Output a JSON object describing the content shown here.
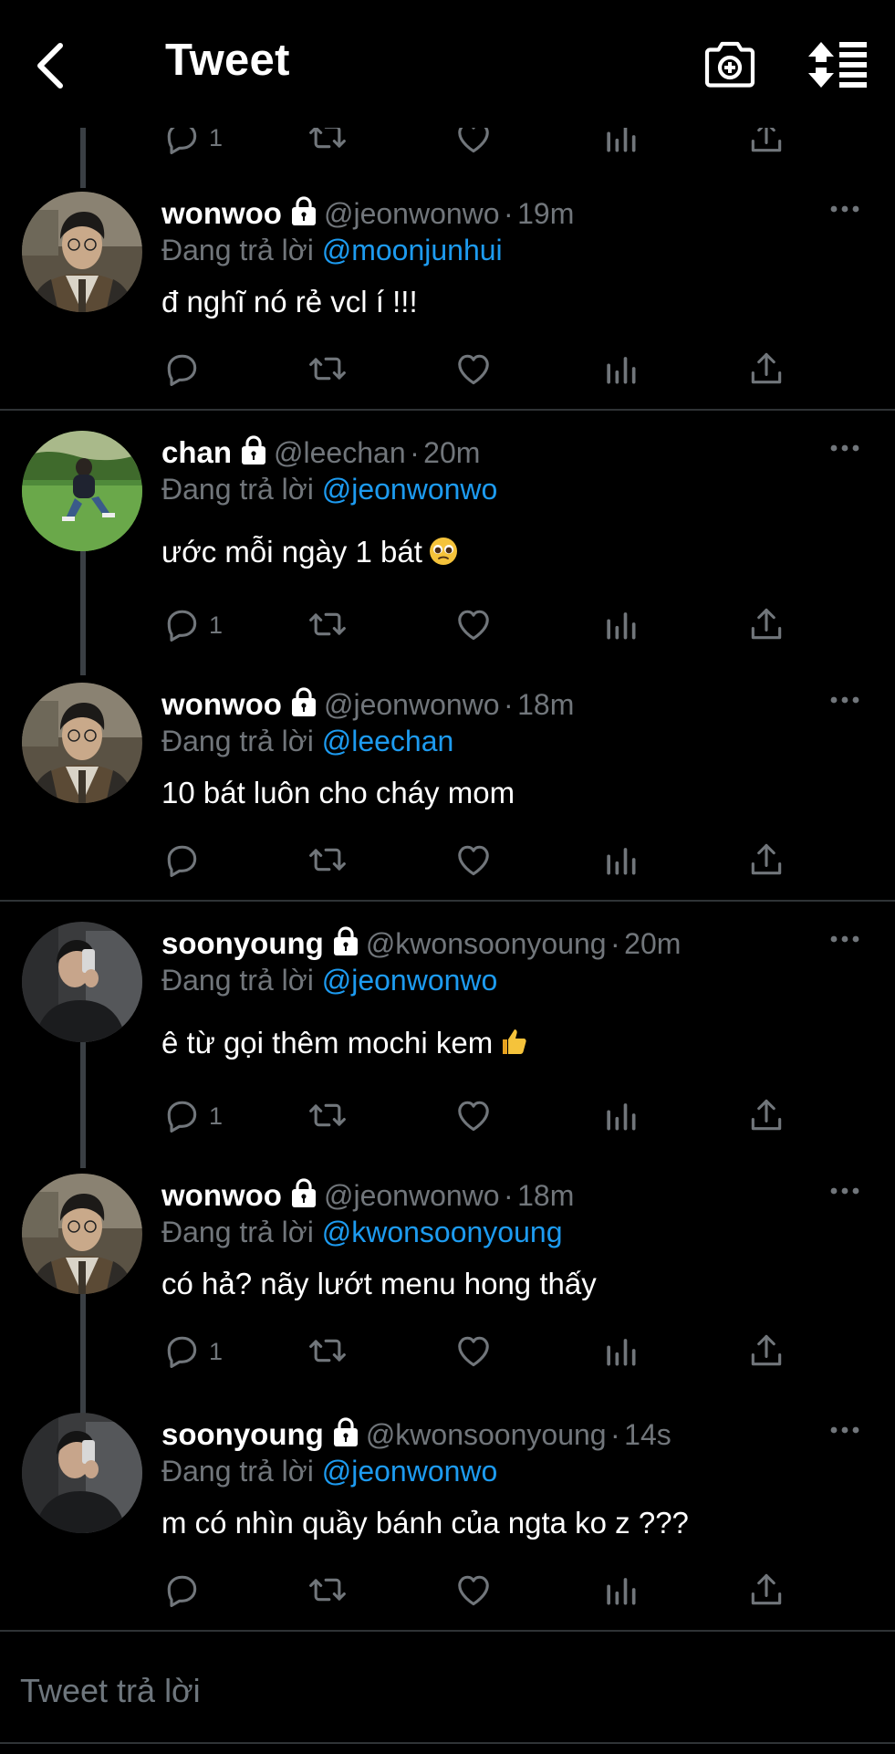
{
  "header": {
    "title": "Tweet",
    "back_icon": "chevron-left-icon",
    "camera_icon": "camera-add-icon",
    "sort_icon": "sort-replies-icon"
  },
  "colors": {
    "background": "#000000",
    "text": "#ffffff",
    "muted": "#71767b",
    "accent": "#1d9bf0",
    "divider": "#2f3336"
  },
  "top_partial": {
    "reply_count": "1"
  },
  "reply_prefix": "Đang trả lời",
  "tweets": [
    {
      "name": "wonwoo",
      "handle": "@jeonwonwo",
      "sep": "·",
      "time": "19m",
      "mention": "@moonjunhui",
      "text": "đ nghĩ nó rẻ vcl í !!!",
      "reply_count": "",
      "avatar": "wonwoo"
    },
    {
      "name": "chan",
      "handle": "@leechan",
      "sep": "·",
      "time": "20m",
      "mention": "@jeonwonwo",
      "text": "ước mỗi ngày 1 bát",
      "emoji": "pleading-face-emoji",
      "reply_count": "1",
      "avatar": "chan"
    },
    {
      "name": "wonwoo",
      "handle": "@jeonwonwo",
      "sep": "·",
      "time": "18m",
      "mention": "@leechan",
      "text": "10 bát luôn cho cháy mom",
      "reply_count": "",
      "avatar": "wonwoo"
    },
    {
      "name": "soonyoung",
      "handle": "@kwonsoonyoung",
      "sep": "·",
      "time": "20m",
      "mention": "@jeonwonwo",
      "text": "ê từ gọi thêm mochi kem",
      "emoji": "thumbs-up-emoji",
      "reply_count": "1",
      "avatar": "soonyoung"
    },
    {
      "name": "wonwoo",
      "handle": "@jeonwonwo",
      "sep": "·",
      "time": "18m",
      "mention": "@kwonsoonyoung",
      "text": "có hả? nãy lướt menu hong thấy",
      "reply_count": "1",
      "avatar": "wonwoo"
    },
    {
      "name": "soonyoung",
      "handle": "@kwonsoonyoung",
      "sep": "·",
      "time": "14s",
      "mention": "@jeonwonwo",
      "text": "m có nhìn quầy bánh của ngta ko z ???",
      "reply_count": "",
      "avatar": "soonyoung"
    }
  ],
  "reply_box": {
    "placeholder": "Tweet trả lời"
  }
}
